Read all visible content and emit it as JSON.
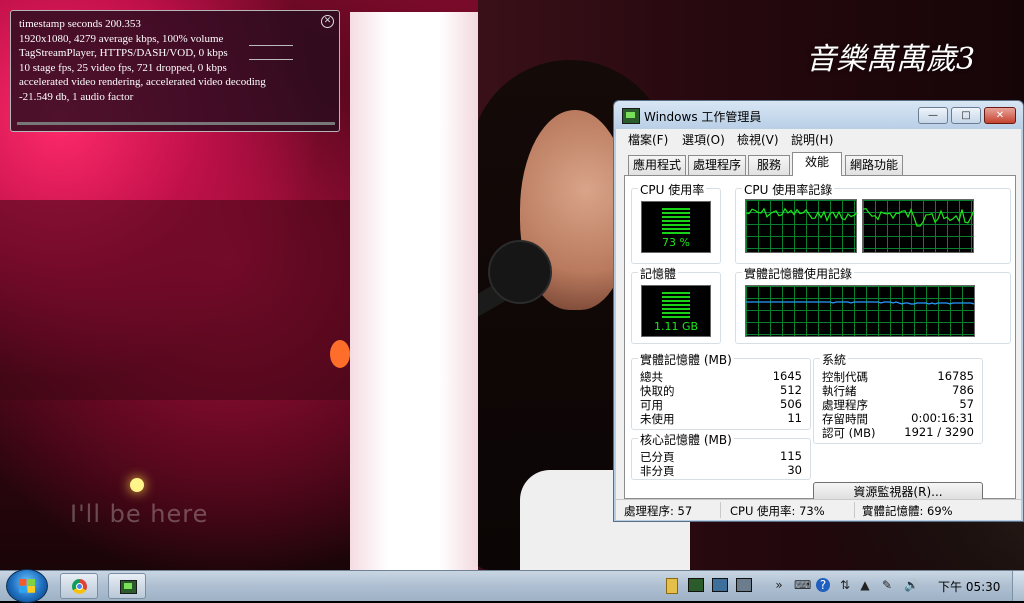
{
  "video": {
    "show_logo": "音樂萬萬歲3",
    "lyric_ghost": "I'll be here"
  },
  "overlay": {
    "lines": [
      "timestamp seconds 200.353",
      "1920x1080, 4279 average kbps, 100% volume",
      "TagStreamPlayer, HTTPS/DASH/VOD, 0 kbps",
      "10 stage fps, 25 video fps, 721 dropped, 0 kbps",
      "accelerated video rendering, accelerated video decoding",
      "-21.549 db, 1 audio factor"
    ],
    "close_icon": "close-icon"
  },
  "taskmanager": {
    "title": "Windows 工作管理員",
    "menu": [
      "檔案(F)",
      "選項(O)",
      "檢視(V)",
      "說明(H)"
    ],
    "tabs": [
      "應用程式",
      "處理程序",
      "服務",
      "效能",
      "網路功能"
    ],
    "active_tab": "效能",
    "cpu_usage_label": "CPU 使用率",
    "cpu_usage_value": "73 %",
    "cpu_usage_fraction": 0.73,
    "cpu_history_label": "CPU 使用率記錄",
    "memory_label": "記憶體",
    "memory_value": "1.11 GB",
    "memory_history_label": "實體記憶體使用記錄",
    "physical_memory": {
      "label": "實體記憶體 (MB)",
      "rows": [
        {
          "k": "總共",
          "v": "1645"
        },
        {
          "k": "快取的",
          "v": "512"
        },
        {
          "k": "可用",
          "v": "506"
        },
        {
          "k": "未使用",
          "v": "11"
        }
      ]
    },
    "kernel_memory": {
      "label": "核心記憶體 (MB)",
      "rows": [
        {
          "k": "已分頁",
          "v": "115"
        },
        {
          "k": "非分頁",
          "v": "30"
        }
      ]
    },
    "system": {
      "label": "系統",
      "rows": [
        {
          "k": "控制代碼",
          "v": "16785"
        },
        {
          "k": "執行緒",
          "v": "786"
        },
        {
          "k": "處理程序",
          "v": "57"
        },
        {
          "k": "存留時間",
          "v": "0:00:16:31"
        },
        {
          "k": "認可 (MB)",
          "v": "1921 / 3290"
        }
      ]
    },
    "resource_monitor_button": "資源監視器(R)...",
    "status": {
      "processes": "處理程序: 57",
      "cpu": "CPU 使用率: 73%",
      "memory": "實體記憶體: 69%"
    },
    "window_buttons": {
      "min": "—",
      "max": "□",
      "close": "✕"
    }
  },
  "taskbar": {
    "clock": "下午 05:30",
    "items": [
      "chrome",
      "task-manager"
    ],
    "tray_glyphs": [
      "»",
      "⌨",
      "?",
      "⇅",
      "▲",
      "✎",
      "🔊"
    ]
  },
  "colors": {
    "graph_line": "#1de81d",
    "memory_line": "#2a9bff",
    "grid": "#0a7f2f"
  }
}
